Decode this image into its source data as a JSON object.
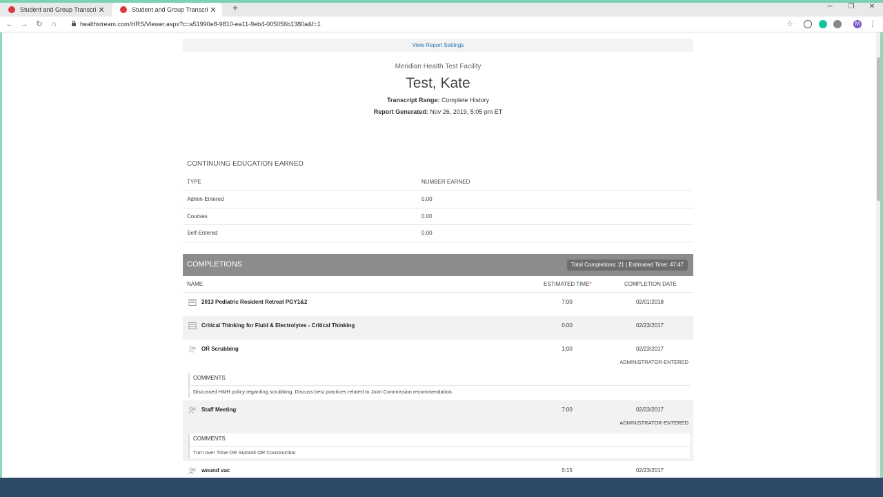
{
  "browser": {
    "tabs": [
      {
        "title": "Student and Group Transcript",
        "active": false
      },
      {
        "title": "Student and Group Transcript",
        "active": true
      }
    ],
    "new_tab": "+",
    "url": "healthstream.com/HRS/Viewer.aspx?c=a51990e8-9810-ea11-9eb4-005056b1380a&f=1",
    "profile_initial": "M"
  },
  "report": {
    "settings_link": "View Report Settings",
    "facility": "Meridian Health Test Facility",
    "student_name": "Test, Kate",
    "range_label": "Transcript Range:",
    "range_value": "Complete History",
    "generated_label": "Report Generated:",
    "generated_value": "Nov 26, 2019, 5:05 pm ET"
  },
  "ce": {
    "title": "CONTINUING EDUCATION EARNED",
    "col_type": "TYPE",
    "col_number": "NUMBER EARNED",
    "rows": [
      {
        "type": "Admin-Entered",
        "number": "0.00"
      },
      {
        "type": "Courses",
        "number": "0.00"
      },
      {
        "type": "Self-Entered",
        "number": "0.00"
      }
    ]
  },
  "completions": {
    "title": "COMPLETIONS",
    "summary": "Total Completions: 21 | Estimated Time: 47:47",
    "col_name": "NAME",
    "col_time": "ESTIMATED TIME",
    "col_time_marker": "*",
    "col_date": "COMPLETION DATE",
    "comments_label": "COMMENTS",
    "items": [
      {
        "name": "2013 Pediatric Resident Retreat PGY1&2",
        "time": "7:00",
        "date": "02/01/2018",
        "icon": "document-icon"
      },
      {
        "name": "Critical Thinking for Fluid & Electrolytes - Critical Thinking",
        "time": "0:00",
        "date": "02/23/2017",
        "icon": "document-icon"
      },
      {
        "name": "OR Scrubbing",
        "time": "1:00",
        "date": "02/23/2017",
        "icon": "people-icon",
        "source": "ADMINISTRATOR-ENTERED",
        "comment": "Discussed HMH policy regarding scrubbing. Discuss best practices related to Joint Commission recommendation."
      },
      {
        "name": "Staff Meeting",
        "time": "7:00",
        "date": "02/23/2017",
        "icon": "people-icon",
        "source": "ADMINISTRATOR-ENTERED",
        "comment": "Turn over Time OR Summit OR Construction"
      },
      {
        "name": "wound vac",
        "time": "0:15",
        "date": "02/23/2017",
        "icon": "people-icon"
      }
    ]
  },
  "colors": {
    "accent_green": "#7fd1b3",
    "link_blue": "#2a73b6",
    "bar_gray": "#8c8c8c",
    "required_red": "#d9363e",
    "taskbar": "#2e4a66"
  }
}
